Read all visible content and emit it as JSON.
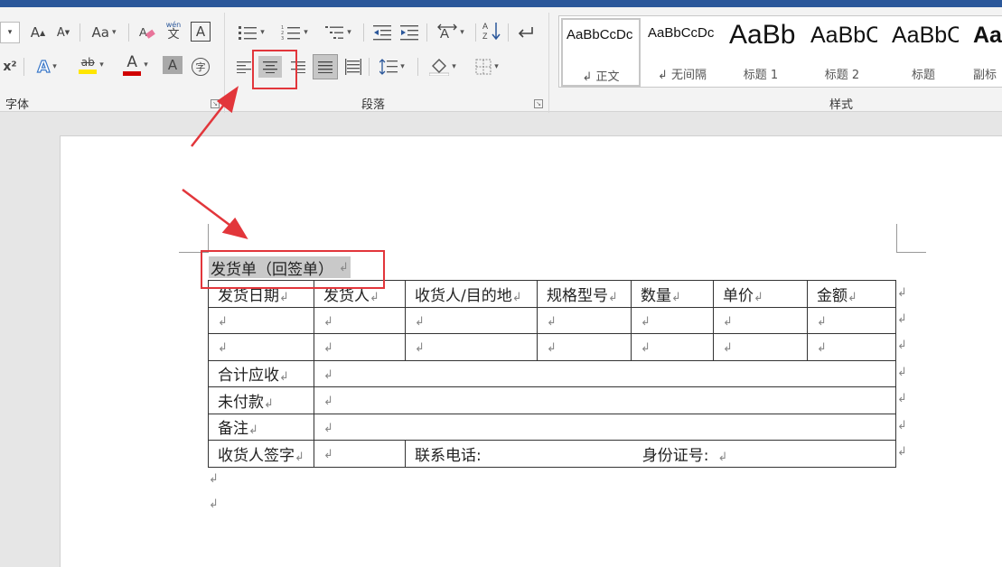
{
  "ribbon": {
    "groups": {
      "font": "字体",
      "paragraph": "段落",
      "styles": "样式"
    },
    "font_buttons": {
      "grow": "A",
      "shrink": "A",
      "case": "Aa",
      "phonetic_top": "wén",
      "phonetic_bottom": "文",
      "border_char": "A",
      "superscript": "x²",
      "text_effect": "A",
      "highlight": "ab",
      "font_color": "A",
      "char_shading": "A",
      "enclose": "字"
    },
    "styles": [
      {
        "preview": "AaBbCcDc",
        "name": "↲ 正文"
      },
      {
        "preview": "AaBbCcDc",
        "name": "↲ 无间隔"
      },
      {
        "preview": "AaBb",
        "name": "标题 1"
      },
      {
        "preview": "AaBbC",
        "name": "标题 2"
      },
      {
        "preview": "AaBbC",
        "name": "标题"
      },
      {
        "preview": "Aa",
        "name": "副标"
      }
    ]
  },
  "document": {
    "paragraph_mark": "↲",
    "title": "发货单（回签单）",
    "headers": [
      "发货日期",
      "发货人",
      "收货人/目的地",
      "规格型号",
      "数量",
      "单价",
      "金额"
    ],
    "summary_rows": [
      "合计应收",
      "未付款",
      "备注"
    ],
    "signature_label": "收货人签字",
    "phone_label": "联系电话:",
    "id_label": "身份证号:"
  },
  "colors": {
    "accent": "#2b579a",
    "annotation": "#e2363b",
    "highlight_yellow": "#ffe600",
    "font_red": "#d00000"
  }
}
